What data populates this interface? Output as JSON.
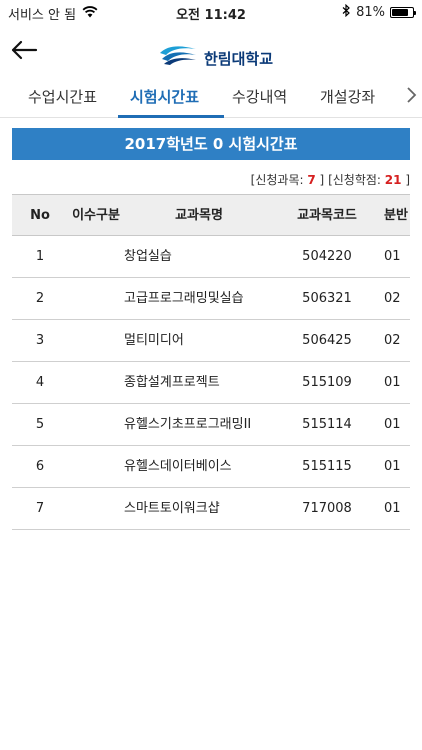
{
  "status_bar": {
    "carrier": "서비스 안 됨",
    "time": "오전 11:42",
    "battery_percent": "81%",
    "battery_level": 0.81
  },
  "header": {
    "back_icon": "arrow-left-icon",
    "logo_text": "한림대학교"
  },
  "tabs": [
    {
      "label": "수업시간표",
      "active": false
    },
    {
      "label": "시험시간표",
      "active": true
    },
    {
      "label": "수강내역",
      "active": false
    },
    {
      "label": "개설강좌",
      "active": false
    }
  ],
  "banner": {
    "title": "2017학년도 0 시험시간표"
  },
  "summary": {
    "subjects_label": "[신청과목:",
    "subjects_value": "7",
    "credits_label": "[신청학점:",
    "credits_value": "21",
    "close_bracket": "]"
  },
  "table": {
    "headers": {
      "no": "No",
      "type": "이수구분",
      "name": "교과목명",
      "code": "교과목코드",
      "section": "분반"
    },
    "rows": [
      {
        "no": "1",
        "type": "",
        "name": "창업실습",
        "code": "504220",
        "section": "01"
      },
      {
        "no": "2",
        "type": "",
        "name": "고급프로그래밍및실습",
        "code": "506321",
        "section": "02"
      },
      {
        "no": "3",
        "type": "",
        "name": "멀티미디어",
        "code": "506425",
        "section": "02"
      },
      {
        "no": "4",
        "type": "",
        "name": "종합설계프로젝트",
        "code": "515109",
        "section": "01"
      },
      {
        "no": "5",
        "type": "",
        "name": "유헬스기초프로그래밍II",
        "code": "515114",
        "section": "01"
      },
      {
        "no": "6",
        "type": "",
        "name": "유헬스데이터베이스",
        "code": "515115",
        "section": "01"
      },
      {
        "no": "7",
        "type": "",
        "name": "스마트토이워크샵",
        "code": "717008",
        "section": "01"
      }
    ]
  },
  "colors": {
    "accent": "#1f6db5",
    "banner": "#2f80c5",
    "highlight": "#d62020"
  }
}
